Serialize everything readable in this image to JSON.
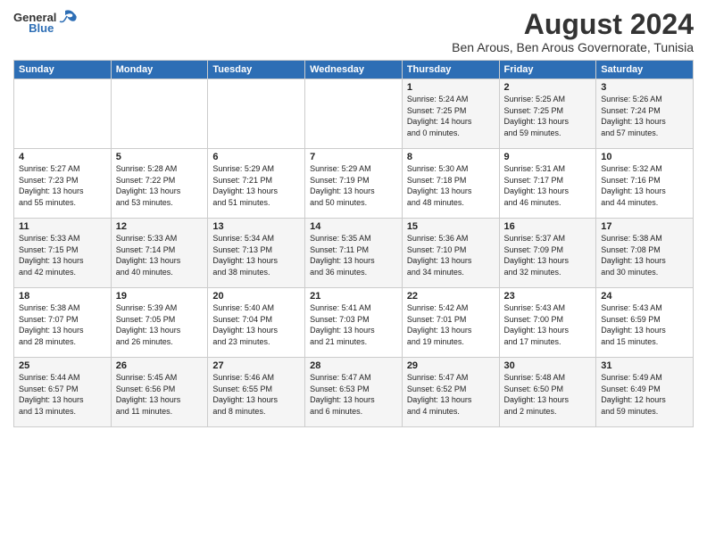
{
  "header": {
    "logo": {
      "general": "General",
      "blue": "Blue"
    },
    "title": "August 2024",
    "subtitle": "Ben Arous, Ben Arous Governorate, Tunisia"
  },
  "days_of_week": [
    "Sunday",
    "Monday",
    "Tuesday",
    "Wednesday",
    "Thursday",
    "Friday",
    "Saturday"
  ],
  "weeks": [
    [
      {
        "day": "",
        "info": ""
      },
      {
        "day": "",
        "info": ""
      },
      {
        "day": "",
        "info": ""
      },
      {
        "day": "",
        "info": ""
      },
      {
        "day": "1",
        "info": "Sunrise: 5:24 AM\nSunset: 7:25 PM\nDaylight: 14 hours\nand 0 minutes."
      },
      {
        "day": "2",
        "info": "Sunrise: 5:25 AM\nSunset: 7:25 PM\nDaylight: 13 hours\nand 59 minutes."
      },
      {
        "day": "3",
        "info": "Sunrise: 5:26 AM\nSunset: 7:24 PM\nDaylight: 13 hours\nand 57 minutes."
      }
    ],
    [
      {
        "day": "4",
        "info": "Sunrise: 5:27 AM\nSunset: 7:23 PM\nDaylight: 13 hours\nand 55 minutes."
      },
      {
        "day": "5",
        "info": "Sunrise: 5:28 AM\nSunset: 7:22 PM\nDaylight: 13 hours\nand 53 minutes."
      },
      {
        "day": "6",
        "info": "Sunrise: 5:29 AM\nSunset: 7:21 PM\nDaylight: 13 hours\nand 51 minutes."
      },
      {
        "day": "7",
        "info": "Sunrise: 5:29 AM\nSunset: 7:19 PM\nDaylight: 13 hours\nand 50 minutes."
      },
      {
        "day": "8",
        "info": "Sunrise: 5:30 AM\nSunset: 7:18 PM\nDaylight: 13 hours\nand 48 minutes."
      },
      {
        "day": "9",
        "info": "Sunrise: 5:31 AM\nSunset: 7:17 PM\nDaylight: 13 hours\nand 46 minutes."
      },
      {
        "day": "10",
        "info": "Sunrise: 5:32 AM\nSunset: 7:16 PM\nDaylight: 13 hours\nand 44 minutes."
      }
    ],
    [
      {
        "day": "11",
        "info": "Sunrise: 5:33 AM\nSunset: 7:15 PM\nDaylight: 13 hours\nand 42 minutes."
      },
      {
        "day": "12",
        "info": "Sunrise: 5:33 AM\nSunset: 7:14 PM\nDaylight: 13 hours\nand 40 minutes."
      },
      {
        "day": "13",
        "info": "Sunrise: 5:34 AM\nSunset: 7:13 PM\nDaylight: 13 hours\nand 38 minutes."
      },
      {
        "day": "14",
        "info": "Sunrise: 5:35 AM\nSunset: 7:11 PM\nDaylight: 13 hours\nand 36 minutes."
      },
      {
        "day": "15",
        "info": "Sunrise: 5:36 AM\nSunset: 7:10 PM\nDaylight: 13 hours\nand 34 minutes."
      },
      {
        "day": "16",
        "info": "Sunrise: 5:37 AM\nSunset: 7:09 PM\nDaylight: 13 hours\nand 32 minutes."
      },
      {
        "day": "17",
        "info": "Sunrise: 5:38 AM\nSunset: 7:08 PM\nDaylight: 13 hours\nand 30 minutes."
      }
    ],
    [
      {
        "day": "18",
        "info": "Sunrise: 5:38 AM\nSunset: 7:07 PM\nDaylight: 13 hours\nand 28 minutes."
      },
      {
        "day": "19",
        "info": "Sunrise: 5:39 AM\nSunset: 7:05 PM\nDaylight: 13 hours\nand 26 minutes."
      },
      {
        "day": "20",
        "info": "Sunrise: 5:40 AM\nSunset: 7:04 PM\nDaylight: 13 hours\nand 23 minutes."
      },
      {
        "day": "21",
        "info": "Sunrise: 5:41 AM\nSunset: 7:03 PM\nDaylight: 13 hours\nand 21 minutes."
      },
      {
        "day": "22",
        "info": "Sunrise: 5:42 AM\nSunset: 7:01 PM\nDaylight: 13 hours\nand 19 minutes."
      },
      {
        "day": "23",
        "info": "Sunrise: 5:43 AM\nSunset: 7:00 PM\nDaylight: 13 hours\nand 17 minutes."
      },
      {
        "day": "24",
        "info": "Sunrise: 5:43 AM\nSunset: 6:59 PM\nDaylight: 13 hours\nand 15 minutes."
      }
    ],
    [
      {
        "day": "25",
        "info": "Sunrise: 5:44 AM\nSunset: 6:57 PM\nDaylight: 13 hours\nand 13 minutes."
      },
      {
        "day": "26",
        "info": "Sunrise: 5:45 AM\nSunset: 6:56 PM\nDaylight: 13 hours\nand 11 minutes."
      },
      {
        "day": "27",
        "info": "Sunrise: 5:46 AM\nSunset: 6:55 PM\nDaylight: 13 hours\nand 8 minutes."
      },
      {
        "day": "28",
        "info": "Sunrise: 5:47 AM\nSunset: 6:53 PM\nDaylight: 13 hours\nand 6 minutes."
      },
      {
        "day": "29",
        "info": "Sunrise: 5:47 AM\nSunset: 6:52 PM\nDaylight: 13 hours\nand 4 minutes."
      },
      {
        "day": "30",
        "info": "Sunrise: 5:48 AM\nSunset: 6:50 PM\nDaylight: 13 hours\nand 2 minutes."
      },
      {
        "day": "31",
        "info": "Sunrise: 5:49 AM\nSunset: 6:49 PM\nDaylight: 12 hours\nand 59 minutes."
      }
    ]
  ]
}
